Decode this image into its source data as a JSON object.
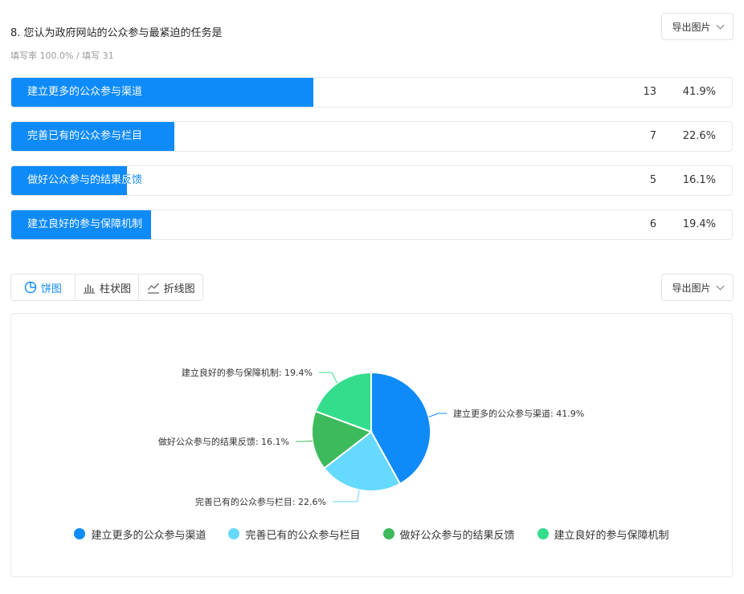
{
  "question": {
    "title": "8. 您认为政府网站的公众参与最紧迫的任务是",
    "subtitle": "填写率 100.0% / 填写 31"
  },
  "export_button_label": "导出图片",
  "view_tabs": [
    {
      "label": "饼图",
      "icon": "pie-chart-icon",
      "active": true
    },
    {
      "label": "柱状图",
      "icon": "bar-chart-icon",
      "active": false
    },
    {
      "label": "折线图",
      "icon": "line-chart-icon",
      "active": false
    }
  ],
  "options": [
    {
      "label": "建立更多的公众参与渠道",
      "count": "13",
      "percent": "41.9%",
      "fraction": 0.419
    },
    {
      "label": "完善已有的公众参与栏目",
      "count": "7",
      "percent": "22.6%",
      "fraction": 0.226
    },
    {
      "label": "做好公众参与的结果反馈",
      "count": "5",
      "percent": "16.1%",
      "fraction": 0.161
    },
    {
      "label": "建立良好的参与保障机制",
      "count": "6",
      "percent": "19.4%",
      "fraction": 0.194
    }
  ],
  "colors": {
    "bar_fill": "#0f8bf9",
    "series": [
      "#0f8bf9",
      "#66d9ff",
      "#3dba5c",
      "#33dd8c"
    ]
  },
  "chart_data": {
    "type": "pie",
    "categories": [
      "建立更多的公众参与渠道",
      "完善已有的公众参与栏目",
      "做好公众参与的结果反馈",
      "建立良好的参与保障机制"
    ],
    "values": [
      13,
      7,
      5,
      6
    ],
    "percent_labels": [
      "41.9%",
      "22.6%",
      "16.1%",
      "19.4%"
    ],
    "slice_labels": [
      "建立更多的公众参与渠道: 41.9%",
      "完善已有的公众参与栏目: 22.6%",
      "做好公众参与的结果反馈: 16.1%",
      "建立良好的参与保障机制: 19.4%"
    ],
    "legend_position": "bottom",
    "start_angle": "top, clockwise"
  }
}
